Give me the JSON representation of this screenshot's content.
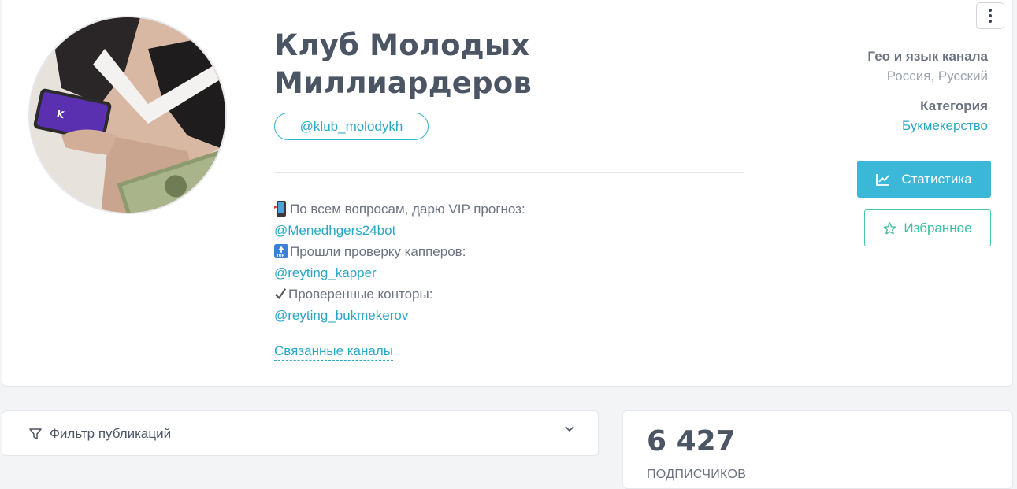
{
  "channel": {
    "title": "Клуб Молодых Миллиардеров",
    "username": "@klub_molodykh",
    "description": [
      {
        "icon": "mobile-phone-emoji-icon",
        "text": "По всем вопросам, дарю VIP прогноз:"
      },
      {
        "link": "@Menedhgers24bot"
      },
      {
        "icon": "top-arrow-emoji-icon",
        "text": "Прошли проверку капперов:"
      },
      {
        "link": "@reyting_kapper"
      },
      {
        "icon": "check-mark-icon",
        "text": "Проверенные конторы:"
      },
      {
        "link": "@reyting_bukmekerov"
      }
    ],
    "related_link": "Связанные каналы"
  },
  "meta": {
    "geo_label": "Гео и язык канала",
    "geo_value": "Россия, Русский",
    "category_label": "Категория",
    "category_value": "Букмекерство"
  },
  "actions": {
    "stats_label": "Статистика",
    "favorite_label": "Избранное"
  },
  "filter": {
    "label": "Фильтр публикаций"
  },
  "stats": {
    "subscribers_count": "6 427",
    "subscribers_label": "ПОДПИСЧИКОВ"
  },
  "colors": {
    "accent": "#2aa7c6",
    "button_blue": "#3bb8d7",
    "favorite_green": "#3bbf9e",
    "background": "#f3f4f6"
  }
}
